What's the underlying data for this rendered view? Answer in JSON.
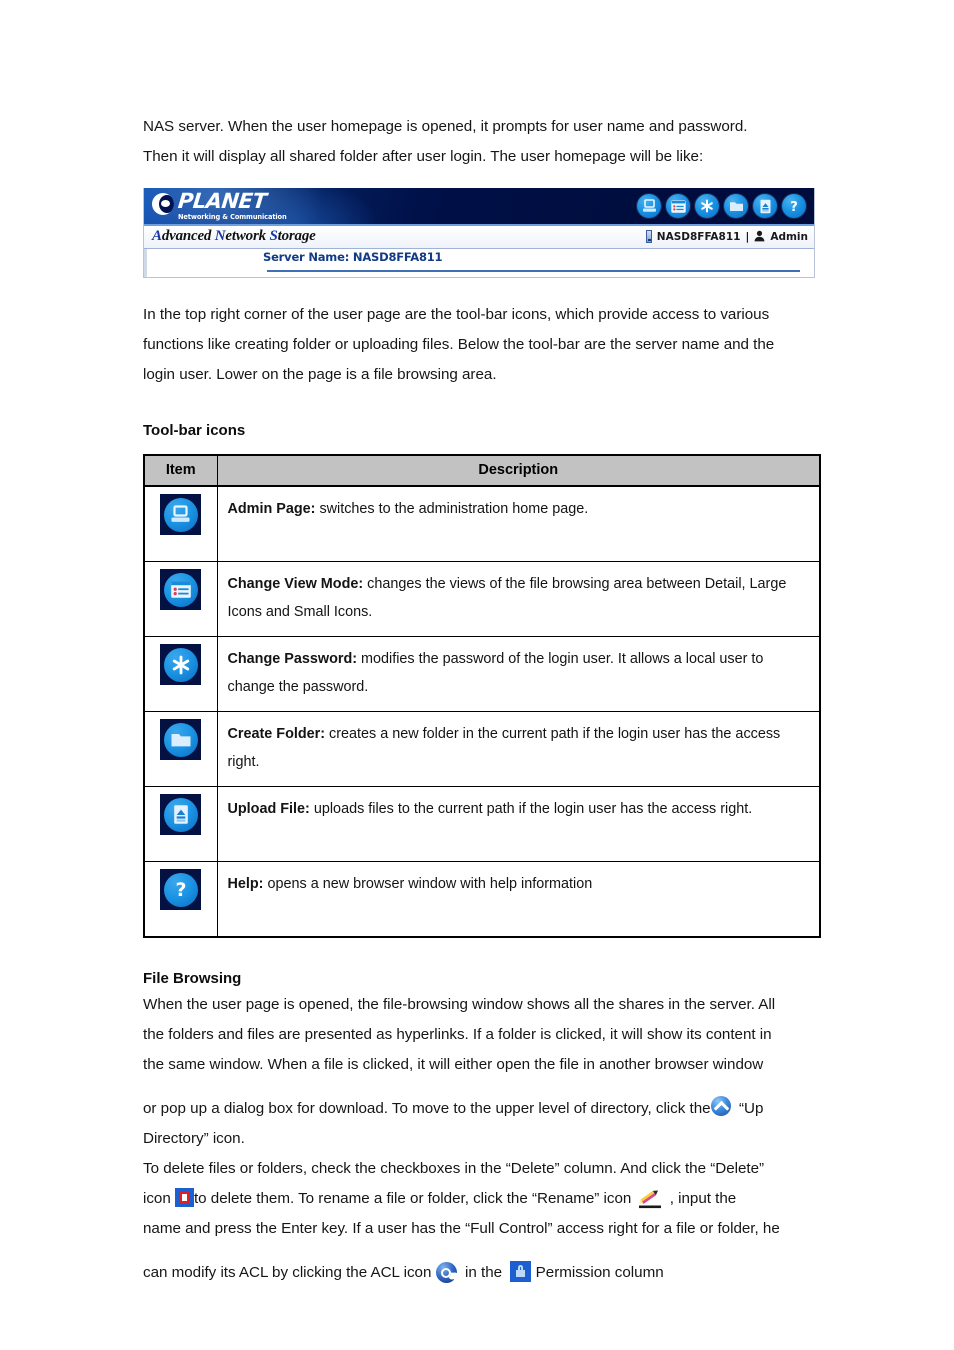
{
  "intro": {
    "line1": "NAS server. When the user homepage is opened, it prompts for user name and password.",
    "line2": "Then it will display all shared folder after user login. The user homepage will be like:"
  },
  "screenshot": {
    "logo_name": "PLANET",
    "logo_tagline": "Networking & Communication",
    "product_title_a": "A",
    "product_title_dvanced": "dvanced ",
    "product_title_n": "N",
    "product_title_etwork": "etwork ",
    "product_title_s": "S",
    "product_title_torage": "torage",
    "device_name": "NASD8FFA811",
    "separator": "|",
    "user_label": "Admin",
    "server_name_label": "Server Name: NASD8FFA811",
    "toolbar_icons": [
      {
        "name": "admin-page-icon",
        "title": "Admin Page"
      },
      {
        "name": "change-view-mode-icon",
        "title": "Change View Mode"
      },
      {
        "name": "change-password-icon",
        "title": "Change Password"
      },
      {
        "name": "create-folder-icon",
        "title": "Create Folder"
      },
      {
        "name": "upload-file-icon",
        "title": "Upload File"
      },
      {
        "name": "help-icon",
        "title": "Help"
      }
    ]
  },
  "para_toolbar": {
    "line1": "In the top right corner of the user page are the tool-bar icons, which provide access to various",
    "line2": "functions like creating folder or uploading files. Below the tool-bar are the server name and the",
    "line3": "login user. Lower on the page is a file browsing area."
  },
  "toolbar_table": {
    "heading": "Tool-bar icons",
    "columns": [
      "Item",
      "Description"
    ],
    "rows": [
      {
        "icon": "admin-page-icon",
        "title": "Admin Page:",
        "desc": " switches to the administration home page."
      },
      {
        "icon": "change-view-mode-icon",
        "title": "Change View Mode:",
        "desc": " changes the views of the file browsing area between Detail, Large Icons and Small Icons."
      },
      {
        "icon": "change-password-icon",
        "title": "Change Password:",
        "desc": " modifies the password of the login user. It allows a local user to change the password."
      },
      {
        "icon": "create-folder-icon",
        "title": "Create Folder:",
        "desc": " creates a new folder in the current path if the login user has the access right."
      },
      {
        "icon": "upload-file-icon",
        "title": "Upload File:",
        "desc": " uploads files to the current path if the login user has the access right."
      },
      {
        "icon": "help-icon",
        "title": "Help:",
        "desc": " opens a new browser window with help information"
      }
    ]
  },
  "file_browsing": {
    "heading": "File Browsing",
    "p1_line1": "When the user page is opened, the file-browsing window shows all the shares in the server. All",
    "p1_line2": "the folders and files are presented as hyperlinks. If a folder is clicked, it will show its content in",
    "p1_line3": "the same window. When a file is clicked, it will either open the file in another browser window",
    "p2_before_icon": "or pop up a dialog box for download. To move to the upper level of directory, click the",
    "p2_after_icon": "“Up",
    "p2_line2": "Directory” icon.",
    "p3_line1": "To delete files or folders, check the checkboxes in the “Delete” column. And click the “Delete”",
    "p3_before_trash": "icon",
    "p3_after_trash": "to delete them. To rename a file or folder, click the “Rename” icon",
    "p3_after_pencil": ", input the",
    "p3_line3": "name and press the Enter key. If a user has the “Full Control” access right for a file or folder, he",
    "p4_before_key": "can modify its ACL by clicking the ACL icon",
    "p4_mid": "in the",
    "p4_after_lock": "Permission column"
  }
}
